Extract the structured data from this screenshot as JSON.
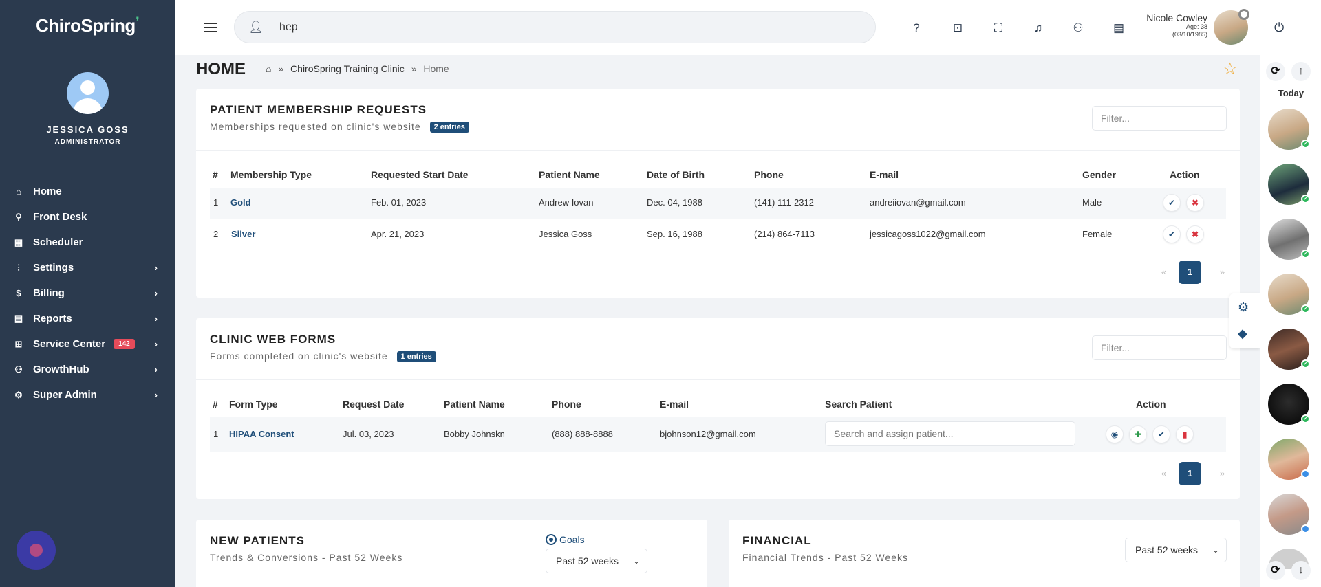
{
  "sidebar": {
    "logo": "ChiroSpring",
    "user_name": "JESSICA GOSS",
    "user_role": "ADMINISTRATOR",
    "items": [
      {
        "label": "Home",
        "icon": "home-icon"
      },
      {
        "label": "Front Desk",
        "icon": "person-icon"
      },
      {
        "label": "Scheduler",
        "icon": "calendar-icon"
      },
      {
        "label": "Settings",
        "icon": "sliders-icon"
      },
      {
        "label": "Billing",
        "icon": "dollar-icon"
      },
      {
        "label": "Reports",
        "icon": "document-icon"
      },
      {
        "label": "Service Center",
        "icon": "grid-icon",
        "badge": "142"
      },
      {
        "label": "GrowthHub",
        "icon": "people-icon"
      },
      {
        "label": "Super Admin",
        "icon": "gear-icon"
      }
    ]
  },
  "topbar": {
    "search_value": "hep",
    "user_name": "Nicole Cowley",
    "user_age": "Age: 38",
    "user_dob": "(03/10/1985)"
  },
  "breadcrumb": {
    "title": "HOME",
    "clinic": "ChiroSpring Training Clinic",
    "current": "Home",
    "sep": "»"
  },
  "membership": {
    "title": "PATIENT MEMBERSHIP REQUESTS",
    "subtitle": "Memberships requested on clinic's website",
    "entries": "2 entries",
    "filter_placeholder": "Filter...",
    "columns": [
      "#",
      "Membership Type",
      "Requested Start Date",
      "Patient Name",
      "Date of Birth",
      "Phone",
      "E-mail",
      "Gender",
      "Action"
    ],
    "rows": [
      {
        "n": "1",
        "type": "Gold",
        "start": "Feb. 01, 2023",
        "name": "Andrew Iovan",
        "dob": "Dec. 04, 1988",
        "phone": "(141) 111-2312",
        "email": "andreiiovan@gmail.com",
        "gender": "Male"
      },
      {
        "n": "2",
        "type": "Silver",
        "start": "Apr. 21, 2023",
        "name": "Jessica Goss",
        "dob": "Sep. 16, 1988",
        "phone": "(214) 864-7113",
        "email": "jessicagoss1022@gmail.com",
        "gender": "Female"
      }
    ],
    "pager": {
      "prev": "«",
      "page": "1",
      "next": "»"
    }
  },
  "webforms": {
    "title": "CLINIC WEB FORMS",
    "subtitle": "Forms completed on clinic's website",
    "entries": "1 entries",
    "filter_placeholder": "Filter...",
    "columns": [
      "#",
      "Form Type",
      "Request Date",
      "Patient Name",
      "Phone",
      "E-mail",
      "Search Patient",
      "Action"
    ],
    "rows": [
      {
        "n": "1",
        "type": "HIPAA Consent",
        "date": "Jul. 03, 2023",
        "name": "Bobby Johnskn",
        "phone": "(888) 888-8888",
        "email": "bjohnson12@gmail.com",
        "search_placeholder": "Search and assign patient..."
      }
    ],
    "pager": {
      "prev": "«",
      "page": "1",
      "next": "»"
    }
  },
  "new_patients": {
    "title": "NEW PATIENTS",
    "subtitle": "Trends & Conversions - Past 52 Weeks",
    "goals_label": "Goals",
    "range": "Past 52 weeks"
  },
  "financial": {
    "title": "FINANCIAL",
    "subtitle": "Financial Trends - Past 52 Weeks",
    "range": "Past 52 weeks"
  },
  "rail": {
    "today": "Today"
  },
  "colors": {
    "sidebar": "#2b3a4e",
    "accent": "#1f4e79",
    "badge": "#e64b5a",
    "online": "#2eb85c",
    "star": "#f0a830"
  }
}
